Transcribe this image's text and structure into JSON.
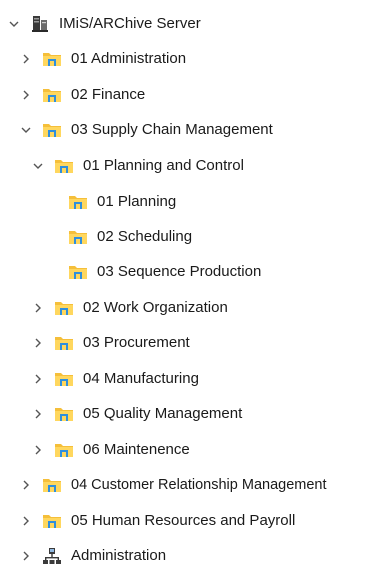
{
  "colors": {
    "folder_top": "#ffd75e",
    "folder_body": "#f5bf3a",
    "folder_blue": "#2f8fdd",
    "chevron": "#555555",
    "server_dark": "#3a3a3a"
  },
  "tree": {
    "root": {
      "label": "IMiS/ARChive Server",
      "icon": "server-icon",
      "expanded": true
    },
    "items": [
      {
        "label": "01 Administration",
        "icon": "folder-icon",
        "expanded": false
      },
      {
        "label": "02 Finance",
        "icon": "folder-icon",
        "expanded": false
      },
      {
        "label": "03 Supply Chain Management",
        "icon": "folder-icon",
        "expanded": true
      },
      {
        "label": "01 Planning and Control",
        "icon": "folder-icon",
        "expanded": true
      },
      {
        "label": "01 Planning",
        "icon": "folder-icon",
        "expanded": null
      },
      {
        "label": "02 Scheduling",
        "icon": "folder-icon",
        "expanded": null
      },
      {
        "label": "03 Sequence Production",
        "icon": "folder-icon",
        "expanded": null
      },
      {
        "label": "02 Work Organization",
        "icon": "folder-icon",
        "expanded": false
      },
      {
        "label": "03 Procurement",
        "icon": "folder-icon",
        "expanded": false
      },
      {
        "label": "04 Manufacturing",
        "icon": "folder-icon",
        "expanded": false
      },
      {
        "label": "05 Quality Management",
        "icon": "folder-icon",
        "expanded": false
      },
      {
        "label": "06 Maintenence",
        "icon": "folder-icon",
        "expanded": false
      },
      {
        "label": "04 Customer Relationship Management",
        "icon": "folder-icon",
        "expanded": false
      },
      {
        "label": "05 Human Resources and Payroll",
        "icon": "folder-icon",
        "expanded": false
      },
      {
        "label": "Administration",
        "icon": "network-admin-icon",
        "expanded": false
      }
    ]
  }
}
